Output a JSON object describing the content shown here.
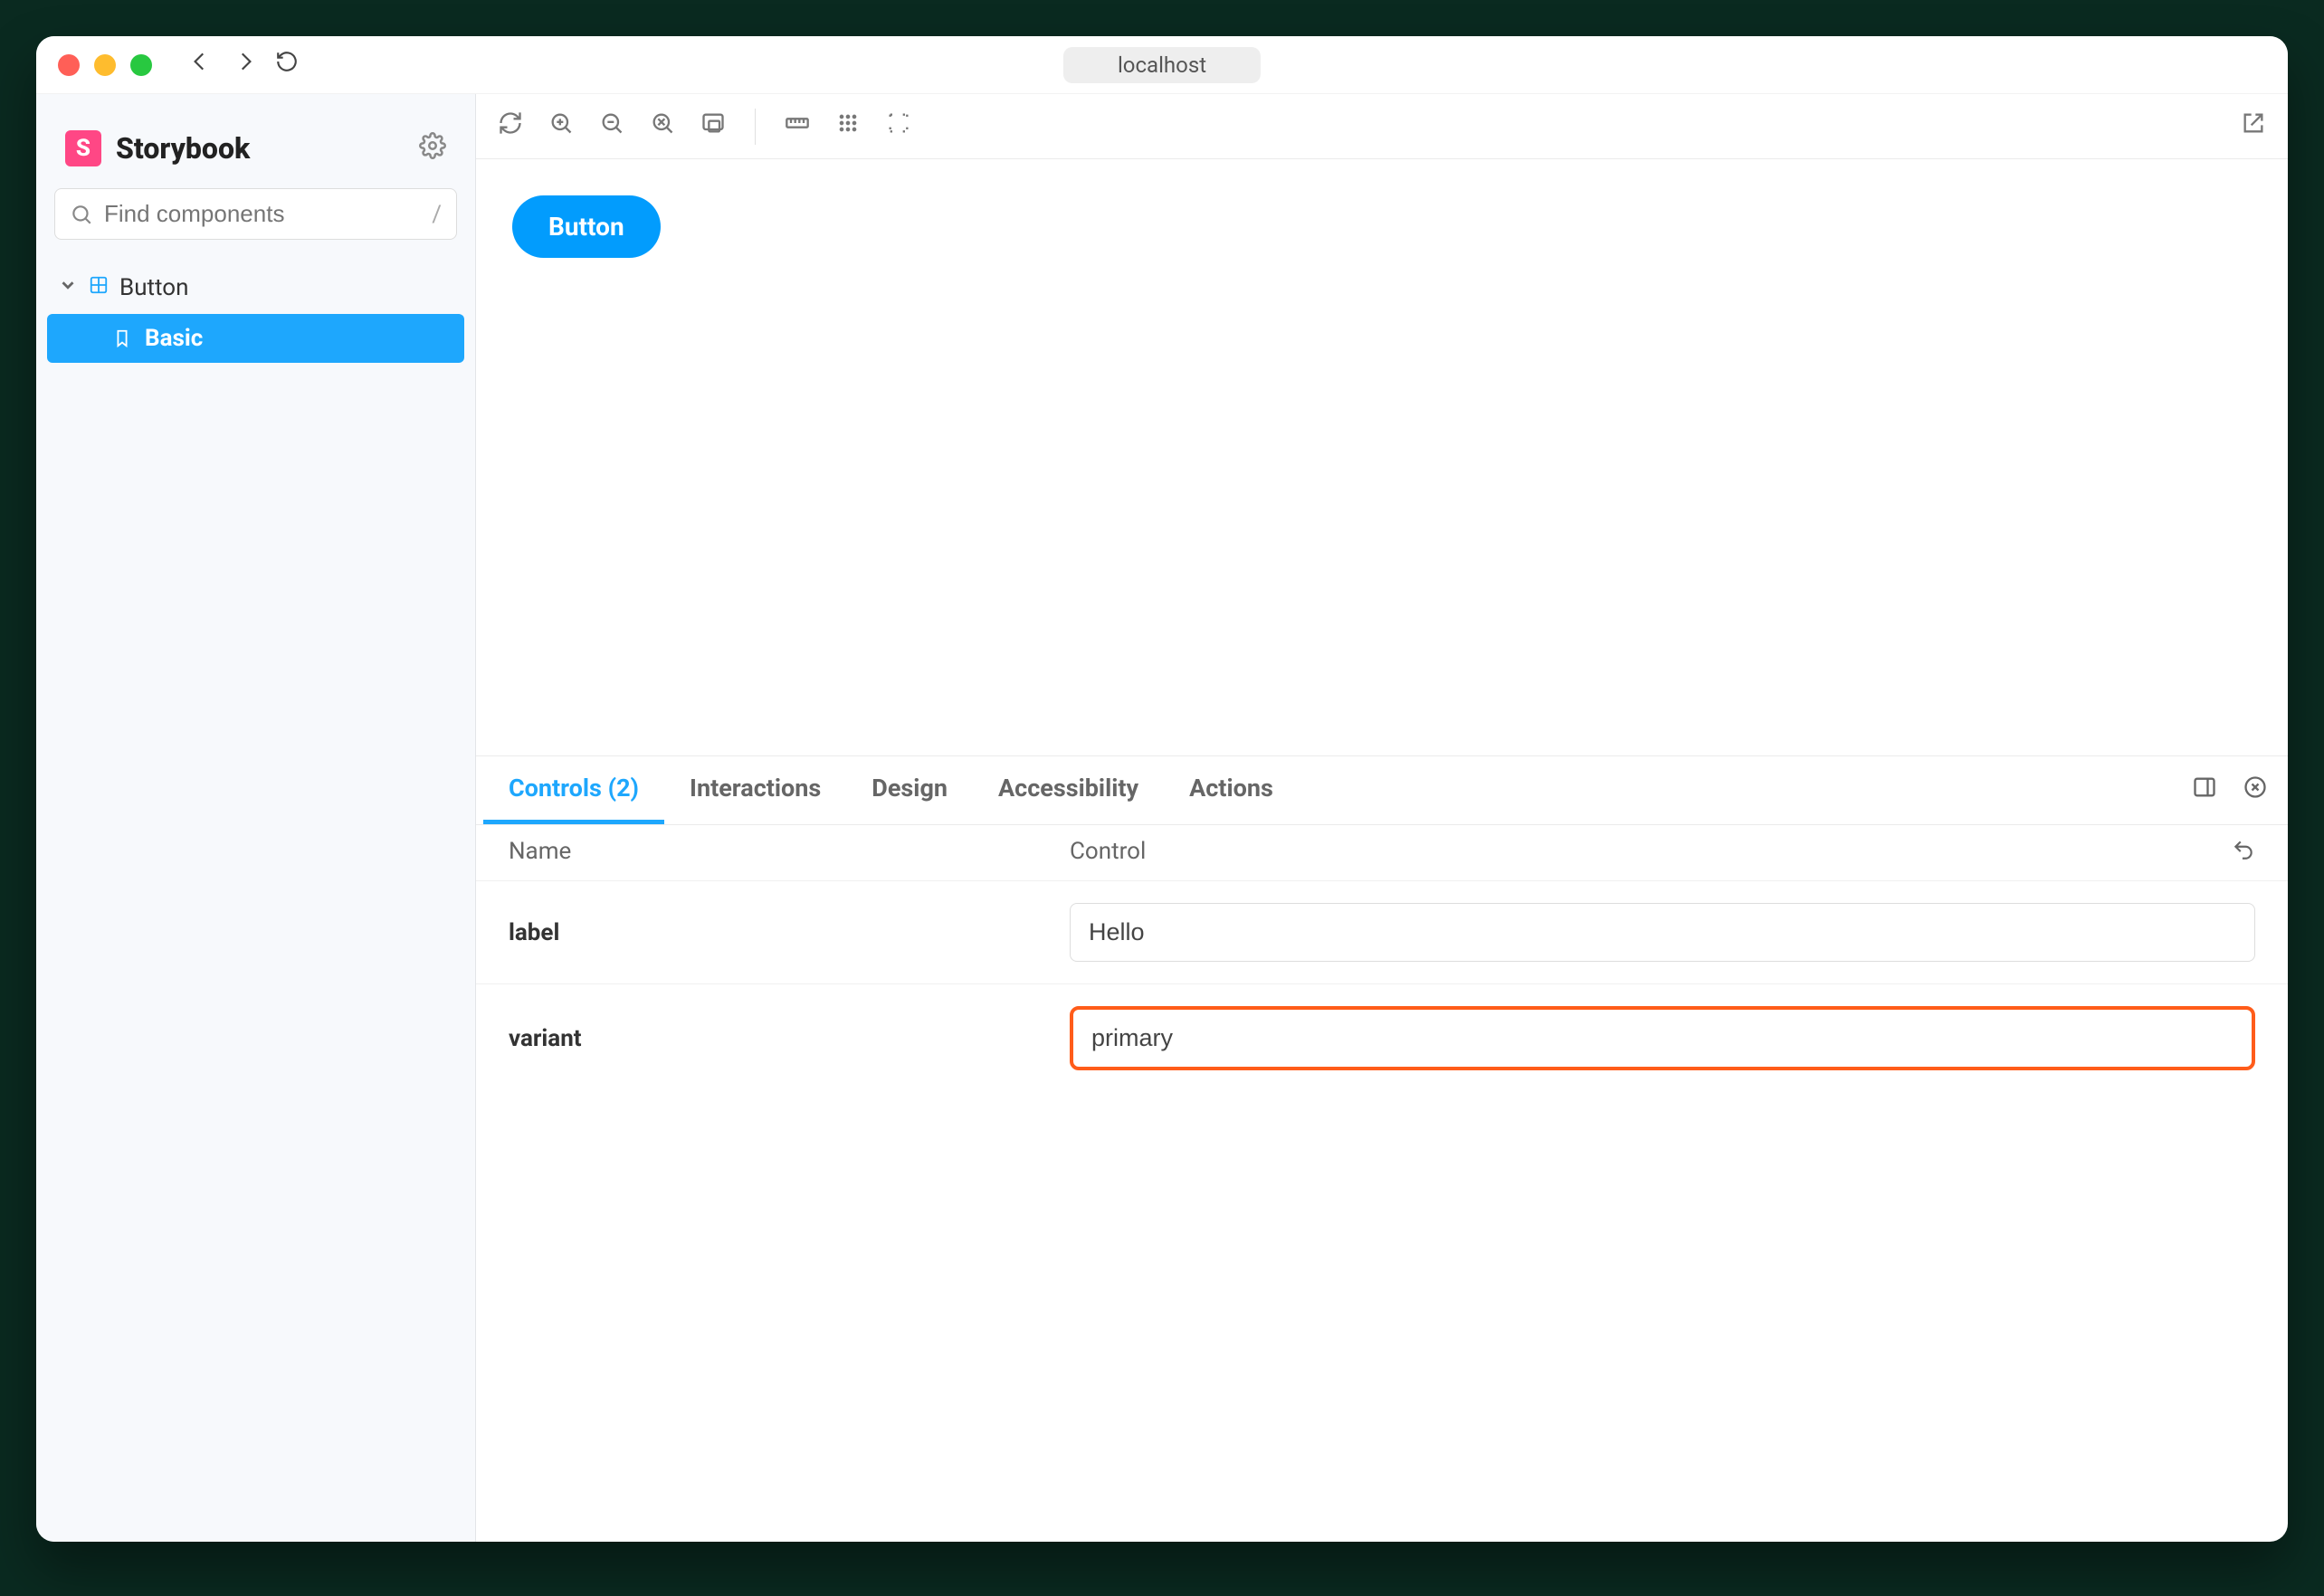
{
  "browser": {
    "address": "localhost"
  },
  "sidebar": {
    "brand": "Storybook",
    "brand_initial": "S",
    "search_placeholder": "Find components",
    "search_shortcut": "/",
    "tree": {
      "component": "Button",
      "story": "Basic"
    }
  },
  "canvas": {
    "button_label": "Button"
  },
  "addons": {
    "tabs": {
      "controls": "Controls (2)",
      "interactions": "Interactions",
      "design": "Design",
      "accessibility": "Accessibility",
      "actions": "Actions"
    },
    "columns": {
      "name": "Name",
      "control": "Control"
    },
    "rows": {
      "label_name": "label",
      "label_value": "Hello",
      "variant_name": "variant",
      "variant_value": "primary"
    }
  }
}
